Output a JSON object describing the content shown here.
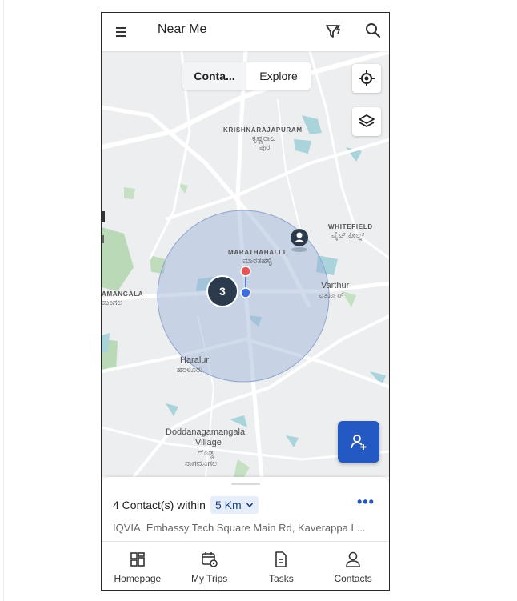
{
  "header": {
    "title": "Near Me",
    "icons": [
      "menu-icon",
      "filter-icon",
      "search-icon"
    ]
  },
  "map": {
    "tabs": [
      {
        "label": "Conta...",
        "active": true
      },
      {
        "label": "Explore",
        "active": false
      }
    ],
    "controls": [
      "locate-icon",
      "layers-icon"
    ],
    "places": {
      "krishnarajapuram": "KRISHNARAJAPURAM",
      "krishnarajapuram_kn1": "ಕೃಷ್ಣರಾಜ",
      "krishnarajapuram_kn2": "ಪುರ",
      "whitefield": "WHITEFIELD",
      "whitefield_kn": "ವೈಟ್ ಫೀಲ್ಡ್",
      "marathahalli": "MARATHAHALLI",
      "marathahalli_kn": "ಮಾರತಹಳ್ಳಿ",
      "mangala": "AMANGALA",
      "mangala_kn": "ಮಂಗಲ",
      "varthur": "Varthur",
      "varthur_kn": "ವರ್ತೂರ್",
      "haralur": "Haralur",
      "haralur_kn": "ಹರಳೂರು",
      "doddanagamangala_1": "Doddanagamangala",
      "doddanagamangala_2": "Village",
      "doddanagamangala_kn1": "ದೊಡ್ಡ",
      "doddanagamangala_kn2": "ನಾಗಮಂಗಲ"
    },
    "cluster_count": "3",
    "colors": {
      "radius_fill": "#9bb0d4",
      "fab": "#2459c4",
      "cluster": "#2c3a4d"
    }
  },
  "sheet": {
    "contacts_text": "4 Contact(s) within",
    "radius": "5 Km",
    "more": "•••",
    "address": "IQVIA, Embassy Tech Square Main Rd, Kaverappa L..."
  },
  "nav": [
    {
      "label": "Homepage",
      "icon": "dashboard-icon"
    },
    {
      "label": "My Trips",
      "icon": "trips-icon"
    },
    {
      "label": "Tasks",
      "icon": "tasks-icon"
    },
    {
      "label": "Contacts",
      "icon": "person-icon"
    }
  ]
}
